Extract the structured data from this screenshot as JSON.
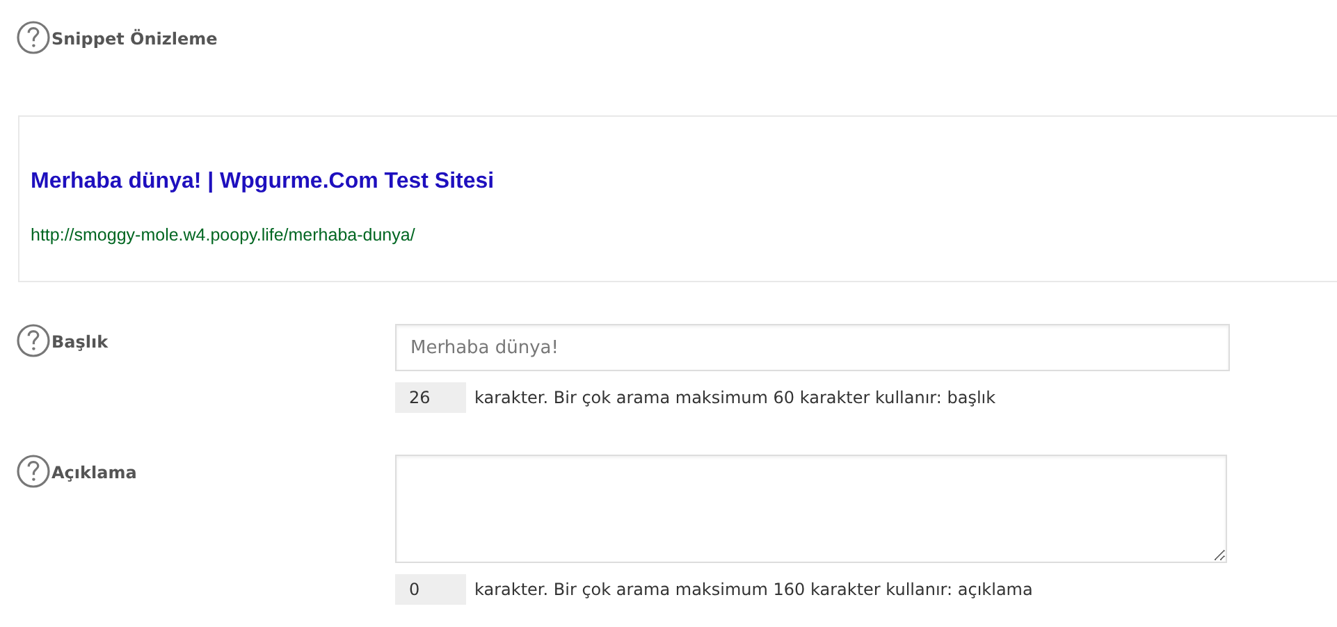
{
  "preview_section": {
    "label": "Snippet Önizleme",
    "title": "Merhaba dünya! | Wpgurme.Com Test Sitesi",
    "url": "http://smoggy-mole.w4.poopy.life/merhaba-dunya/"
  },
  "fields": [
    {
      "kind": "input",
      "label": "Başlık",
      "placeholder": "Merhaba dünya!",
      "count": "26",
      "hint": "karakter. Bir çok arama maksimum 60 karakter kullanır: başlık"
    },
    {
      "kind": "textarea",
      "label": "Açıklama",
      "count": "0",
      "hint": "karakter. Bir çok arama maksimum 160 karakter kullanır: açıklama"
    }
  ]
}
